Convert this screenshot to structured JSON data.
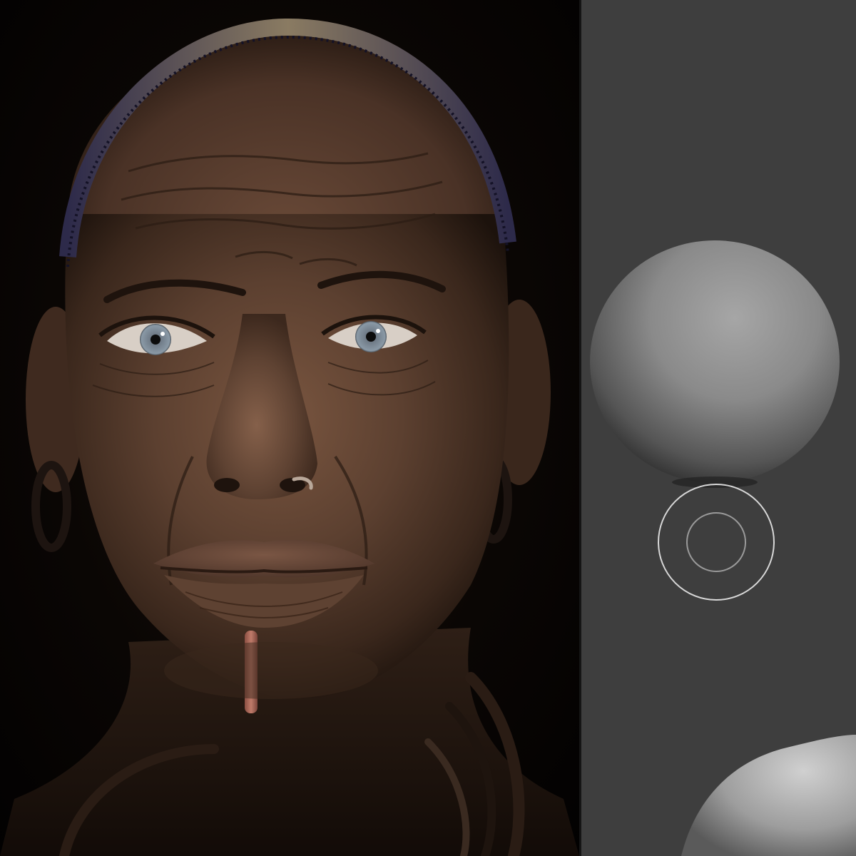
{
  "viewport": {
    "render_background": "#050302",
    "canvas_background": "#3e3e3e",
    "divider_color": "#151515"
  },
  "portrait": {
    "skin_tone": "#5c4030",
    "eye_color": "#8a99a6",
    "lip_plug_color": "#c07b6a",
    "headband_colors": [
      "#2d2a4a",
      "#8a7b62"
    ]
  },
  "sculpt": {
    "sphere_material_color": "#9a9a9a",
    "brush_outer_ring_color": "#d8d8d8",
    "brush_inner_ring_color": "#9a9a9a",
    "icons": [
      "brush-cursor-icon"
    ]
  }
}
